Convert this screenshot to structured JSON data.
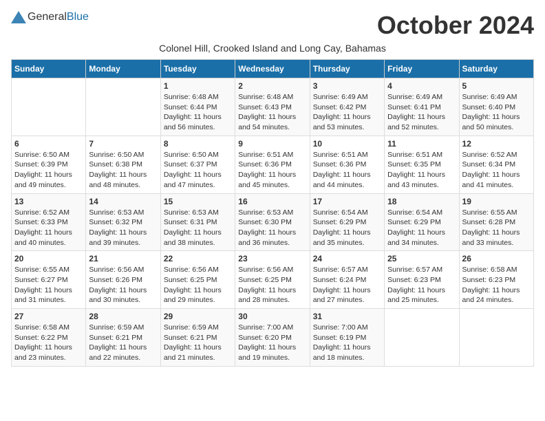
{
  "header": {
    "logo_general": "General",
    "logo_blue": "Blue",
    "month_title": "October 2024",
    "subtitle": "Colonel Hill, Crooked Island and Long Cay, Bahamas"
  },
  "days_of_week": [
    "Sunday",
    "Monday",
    "Tuesday",
    "Wednesday",
    "Thursday",
    "Friday",
    "Saturday"
  ],
  "weeks": [
    [
      {
        "day": "",
        "info": ""
      },
      {
        "day": "",
        "info": ""
      },
      {
        "day": "1",
        "info": "Sunrise: 6:48 AM\nSunset: 6:44 PM\nDaylight: 11 hours and 56 minutes."
      },
      {
        "day": "2",
        "info": "Sunrise: 6:48 AM\nSunset: 6:43 PM\nDaylight: 11 hours and 54 minutes."
      },
      {
        "day": "3",
        "info": "Sunrise: 6:49 AM\nSunset: 6:42 PM\nDaylight: 11 hours and 53 minutes."
      },
      {
        "day": "4",
        "info": "Sunrise: 6:49 AM\nSunset: 6:41 PM\nDaylight: 11 hours and 52 minutes."
      },
      {
        "day": "5",
        "info": "Sunrise: 6:49 AM\nSunset: 6:40 PM\nDaylight: 11 hours and 50 minutes."
      }
    ],
    [
      {
        "day": "6",
        "info": "Sunrise: 6:50 AM\nSunset: 6:39 PM\nDaylight: 11 hours and 49 minutes."
      },
      {
        "day": "7",
        "info": "Sunrise: 6:50 AM\nSunset: 6:38 PM\nDaylight: 11 hours and 48 minutes."
      },
      {
        "day": "8",
        "info": "Sunrise: 6:50 AM\nSunset: 6:37 PM\nDaylight: 11 hours and 47 minutes."
      },
      {
        "day": "9",
        "info": "Sunrise: 6:51 AM\nSunset: 6:36 PM\nDaylight: 11 hours and 45 minutes."
      },
      {
        "day": "10",
        "info": "Sunrise: 6:51 AM\nSunset: 6:36 PM\nDaylight: 11 hours and 44 minutes."
      },
      {
        "day": "11",
        "info": "Sunrise: 6:51 AM\nSunset: 6:35 PM\nDaylight: 11 hours and 43 minutes."
      },
      {
        "day": "12",
        "info": "Sunrise: 6:52 AM\nSunset: 6:34 PM\nDaylight: 11 hours and 41 minutes."
      }
    ],
    [
      {
        "day": "13",
        "info": "Sunrise: 6:52 AM\nSunset: 6:33 PM\nDaylight: 11 hours and 40 minutes."
      },
      {
        "day": "14",
        "info": "Sunrise: 6:53 AM\nSunset: 6:32 PM\nDaylight: 11 hours and 39 minutes."
      },
      {
        "day": "15",
        "info": "Sunrise: 6:53 AM\nSunset: 6:31 PM\nDaylight: 11 hours and 38 minutes."
      },
      {
        "day": "16",
        "info": "Sunrise: 6:53 AM\nSunset: 6:30 PM\nDaylight: 11 hours and 36 minutes."
      },
      {
        "day": "17",
        "info": "Sunrise: 6:54 AM\nSunset: 6:29 PM\nDaylight: 11 hours and 35 minutes."
      },
      {
        "day": "18",
        "info": "Sunrise: 6:54 AM\nSunset: 6:29 PM\nDaylight: 11 hours and 34 minutes."
      },
      {
        "day": "19",
        "info": "Sunrise: 6:55 AM\nSunset: 6:28 PM\nDaylight: 11 hours and 33 minutes."
      }
    ],
    [
      {
        "day": "20",
        "info": "Sunrise: 6:55 AM\nSunset: 6:27 PM\nDaylight: 11 hours and 31 minutes."
      },
      {
        "day": "21",
        "info": "Sunrise: 6:56 AM\nSunset: 6:26 PM\nDaylight: 11 hours and 30 minutes."
      },
      {
        "day": "22",
        "info": "Sunrise: 6:56 AM\nSunset: 6:25 PM\nDaylight: 11 hours and 29 minutes."
      },
      {
        "day": "23",
        "info": "Sunrise: 6:56 AM\nSunset: 6:25 PM\nDaylight: 11 hours and 28 minutes."
      },
      {
        "day": "24",
        "info": "Sunrise: 6:57 AM\nSunset: 6:24 PM\nDaylight: 11 hours and 27 minutes."
      },
      {
        "day": "25",
        "info": "Sunrise: 6:57 AM\nSunset: 6:23 PM\nDaylight: 11 hours and 25 minutes."
      },
      {
        "day": "26",
        "info": "Sunrise: 6:58 AM\nSunset: 6:23 PM\nDaylight: 11 hours and 24 minutes."
      }
    ],
    [
      {
        "day": "27",
        "info": "Sunrise: 6:58 AM\nSunset: 6:22 PM\nDaylight: 11 hours and 23 minutes."
      },
      {
        "day": "28",
        "info": "Sunrise: 6:59 AM\nSunset: 6:21 PM\nDaylight: 11 hours and 22 minutes."
      },
      {
        "day": "29",
        "info": "Sunrise: 6:59 AM\nSunset: 6:21 PM\nDaylight: 11 hours and 21 minutes."
      },
      {
        "day": "30",
        "info": "Sunrise: 7:00 AM\nSunset: 6:20 PM\nDaylight: 11 hours and 19 minutes."
      },
      {
        "day": "31",
        "info": "Sunrise: 7:00 AM\nSunset: 6:19 PM\nDaylight: 11 hours and 18 minutes."
      },
      {
        "day": "",
        "info": ""
      },
      {
        "day": "",
        "info": ""
      }
    ]
  ]
}
